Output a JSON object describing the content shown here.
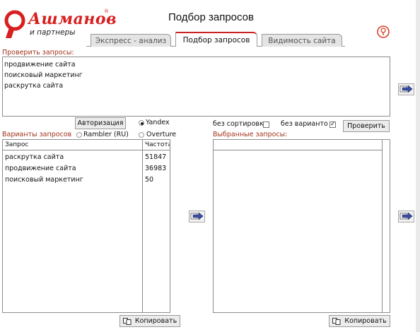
{
  "brand": {
    "name": "Ашманов",
    "registered": "®",
    "tagline": "и партнеры",
    "accent_color": "#d81e1e"
  },
  "header": {
    "title": "Подбор запросов",
    "help_icon": "help-icon"
  },
  "tabs": [
    {
      "label": "Экспресс - анализ",
      "active": false
    },
    {
      "label": "Подбор запросов",
      "active": true
    },
    {
      "label": "Видимость сайта",
      "active": false
    }
  ],
  "check_section": {
    "label": "Проверить запросы:",
    "lines": [
      "продвижение сайта",
      "поисковый маркетинг",
      "раскрутка сайта"
    ]
  },
  "controls": {
    "auth_button": "Авторизация",
    "engines": [
      {
        "label": "Yandex",
        "selected": true
      },
      {
        "label": "Rambler (RU)",
        "selected": false
      },
      {
        "label": "Overture",
        "selected": false
      }
    ],
    "no_sort_label": "без сортировк",
    "no_sort_checked": false,
    "no_variants_label": "без варианто",
    "no_variants_checked": true,
    "check_button": "Проверить"
  },
  "variants": {
    "label": "Варианты запросов",
    "columns": [
      "Запрос",
      "Частота"
    ],
    "rows": [
      {
        "query": "раскрутка сайта",
        "freq": "51847"
      },
      {
        "query": "продвижение сайта",
        "freq": "36983"
      },
      {
        "query": "поисковый маркетинг",
        "freq": "50"
      }
    ],
    "copy_button": "Копировать"
  },
  "selected": {
    "label": "Выбранные запросы:",
    "copy_button": "Копировать"
  },
  "icons": {
    "arrow": "arrow-right-icon",
    "copy": "copy-icon"
  }
}
